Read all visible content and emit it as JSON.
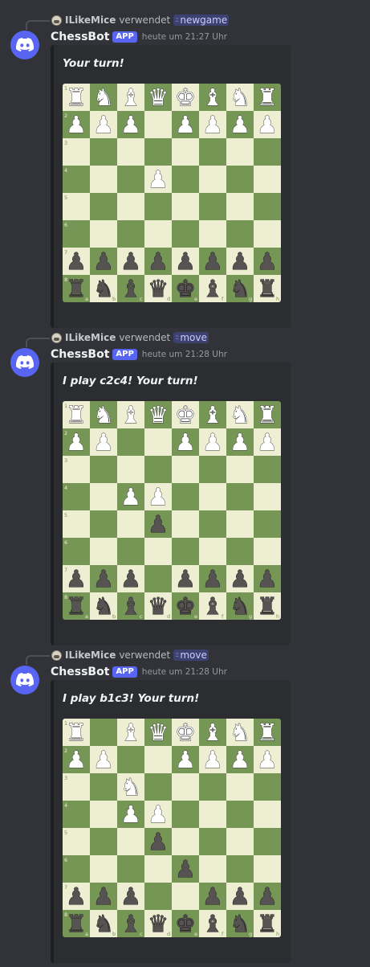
{
  "colors": {
    "light": "#eeeed2",
    "dark": "#769656",
    "white_piece": "#ffffff",
    "black_piece": "#565352"
  },
  "board": {
    "files": [
      "a",
      "b",
      "c",
      "d",
      "e",
      "f",
      "g",
      "h"
    ],
    "ranks": [
      "1",
      "2",
      "3",
      "4",
      "5",
      "6",
      "7",
      "8"
    ]
  },
  "messages": [
    {
      "reply_user": "ILikeMice",
      "reply_verb": "verwendet",
      "reply_command": "newgame",
      "author": "ChessBot",
      "badge": "APP",
      "timestamp": "heute um 21:27 Uhr",
      "text": "Your turn!",
      "fen_rows_rank1_to_8": [
        "RNBQKBNR",
        "PPP.PPPP",
        "........",
        "...P....",
        "........",
        "........",
        "pppppppp",
        "rnbqkbnr"
      ]
    },
    {
      "reply_user": "ILikeMice",
      "reply_verb": "verwendet",
      "reply_command": "move",
      "author": "ChessBot",
      "badge": "APP",
      "timestamp": "heute um 21:28 Uhr",
      "text": "I play c2c4! Your turn!",
      "fen_rows_rank1_to_8": [
        "RNBQKBNR",
        "PP..PPPP",
        "........",
        "..PP....",
        "...p....",
        "........",
        "ppp.pppp",
        "rnbqkbnr"
      ]
    },
    {
      "reply_user": "ILikeMice",
      "reply_verb": "verwendet",
      "reply_command": "move",
      "author": "ChessBot",
      "badge": "APP",
      "timestamp": "heute um 21:28 Uhr",
      "text": "I play b1c3! Your turn!",
      "fen_rows_rank1_to_8": [
        "R.BQKBNR",
        "PP..PPPP",
        "..N.....",
        "..PP....",
        "...p....",
        "....p...",
        "ppp..ppp",
        "rnbqkbnr"
      ]
    }
  ]
}
